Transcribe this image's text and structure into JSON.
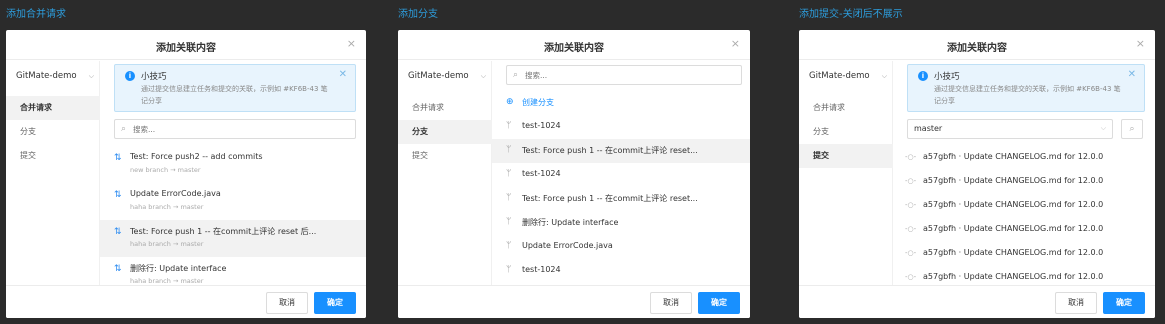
{
  "panels": [
    {
      "title": "添加合并请求"
    },
    {
      "title": "添加分支"
    },
    {
      "title": "添加提交-关闭后不展示"
    }
  ],
  "dialog": {
    "title": "添加关联内容",
    "close": "×",
    "project": "GitMate-demo",
    "sidebar": [
      "合并请求",
      "分支",
      "提交"
    ],
    "search_placeholder": "搜索...",
    "cancel": "取消",
    "ok": "确定"
  },
  "tip": {
    "title": "小技巧",
    "text": "通过提交信息建立任务和提交的关联，示例如 #KF6B-43 笔记分享",
    "icon": "info-icon"
  },
  "merge_requests": [
    {
      "title": "Test: Force push2 -- add commits",
      "sub": "new branch  →  master"
    },
    {
      "title": "Update ErrorCode.java",
      "sub": "haha branch  →  master"
    },
    {
      "title": "Test: Force push 1 -- 在commit上评论 reset 后...",
      "sub": "haha branch  →  master"
    },
    {
      "title": "删除行: Update interface",
      "sub": "haha branch  →  master"
    }
  ],
  "branches": {
    "create": "创建分支",
    "items": [
      "test-1024",
      "Test: Force push 1 -- 在commit上评论 reset...",
      "test-1024",
      "Test: Force push 1 -- 在commit上评论 reset...",
      "删除行: Update interface",
      "Update ErrorCode.java",
      "test-1024"
    ]
  },
  "commits": {
    "branch_select": "master",
    "items": [
      "a57gbfh · Update CHANGELOG.md for 12.0.0",
      "a57gbfh · Update CHANGELOG.md for 12.0.0",
      "a57gbfh · Update CHANGELOG.md for 12.0.0",
      "a57gbfh · Update CHANGELOG.md for 12.0.0",
      "a57gbfh · Update CHANGELOG.md for 12.0.0",
      "a57gbfh · Update CHANGELOG.md for 12.0.0"
    ]
  },
  "colors": {
    "accent": "#1890ff",
    "panel_title": "#2d9cdb",
    "background": "#2b2b2b"
  }
}
